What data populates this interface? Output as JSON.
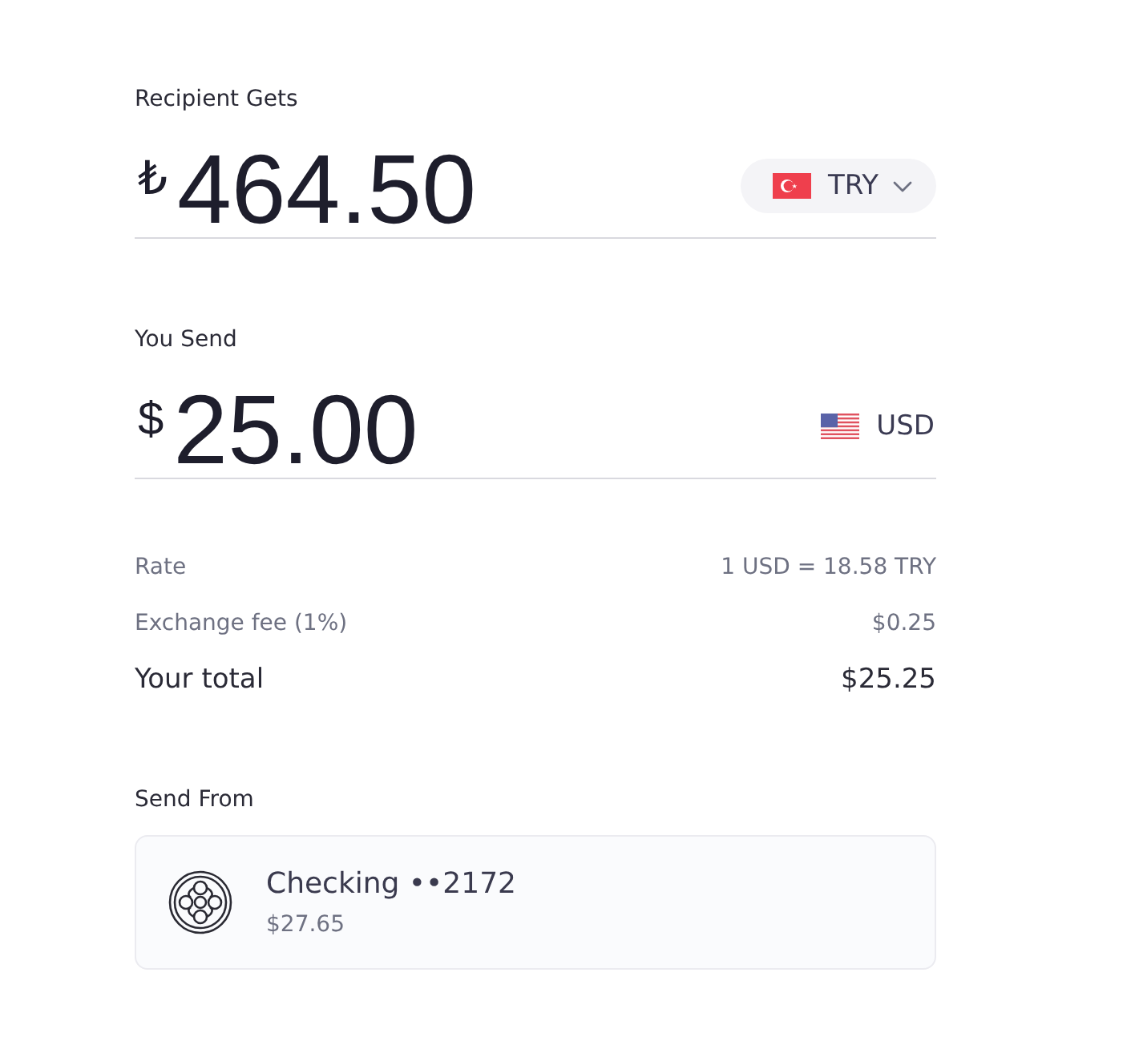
{
  "amount_sections": [
    {
      "label": "Recipient Gets",
      "symbol": "₺",
      "amount": "464.50",
      "currency": {
        "code": "TRY",
        "kind": "tr",
        "dropdown": true
      }
    },
    {
      "label": "You Send",
      "symbol": "$",
      "amount": "25.00",
      "currency": {
        "code": "USD",
        "kind": "us",
        "dropdown": false
      }
    }
  ],
  "summary": [
    {
      "kind": "detail",
      "label": "Rate",
      "value": "1 USD = 18.58 TRY"
    },
    {
      "kind": "detail",
      "label": "Exchange fee (1%)",
      "value": "$0.25"
    },
    {
      "kind": "total",
      "label": "Your total",
      "value": "$25.25"
    }
  ],
  "send_from": {
    "label": "Send From",
    "account": {
      "name": "Checking ••2172",
      "balance": "$27.65"
    }
  }
}
